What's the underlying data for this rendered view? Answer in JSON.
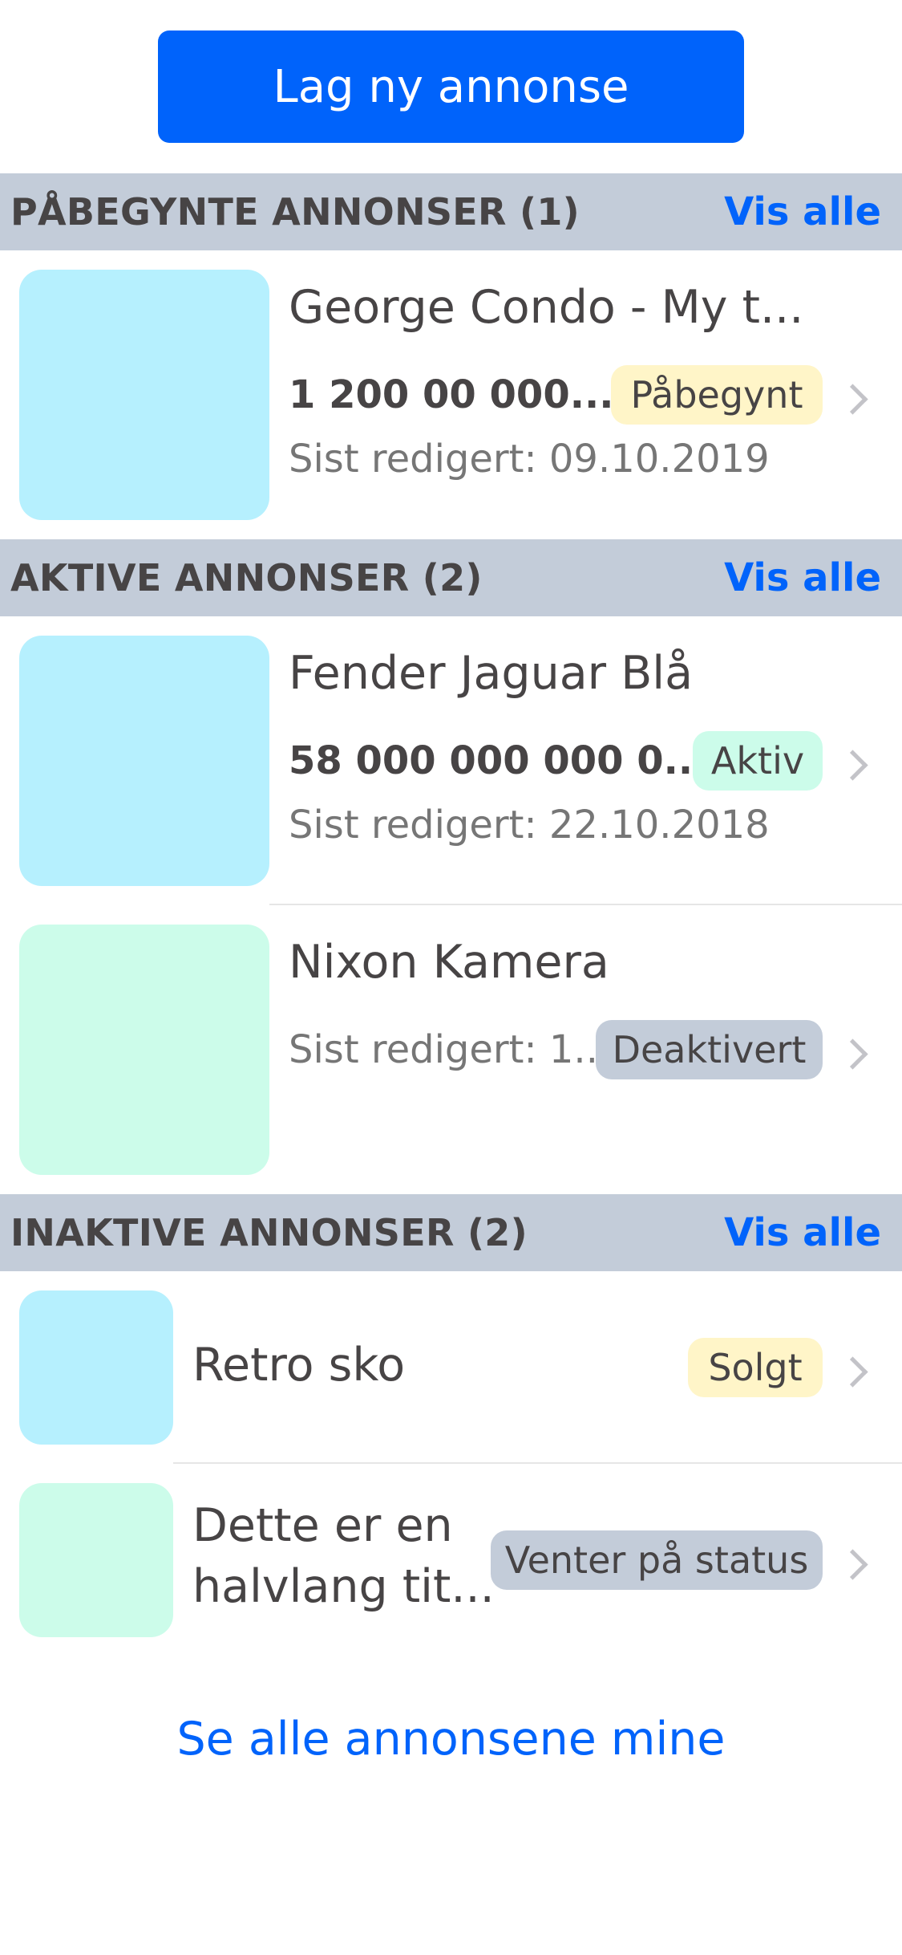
{
  "new_ad_button": "Lag ny annonse",
  "sections": {
    "started": {
      "title": "PÅBEGYNTE ANNONSER (1)",
      "see_all": "Vis alle",
      "items": [
        {
          "title": "George Condo - My t...",
          "price": "1 200 00 000...",
          "status": "Påbegynt",
          "edited": "Sist redigert: 09.10.2019",
          "thumb_color": "#b6f0fe"
        }
      ]
    },
    "active": {
      "title": "AKTIVE ANNONSER (2)",
      "see_all": "Vis alle",
      "items": [
        {
          "title": "Fender Jaguar Blå",
          "price": "58 000 000 000 0...",
          "status": "Aktiv",
          "edited": "Sist redigert: 22.10.2018",
          "thumb_color": "#b6f0fe"
        },
        {
          "title": "Nixon Kamera",
          "edited": "Sist redigert: 1...",
          "status": "Deaktivert",
          "thumb_color": "#ccfcea"
        }
      ]
    },
    "inactive": {
      "title": "INAKTIVE ANNONSER (2)",
      "see_all": "Vis alle",
      "items": [
        {
          "title": "Retro sko",
          "status": "Solgt",
          "thumb_color": "#b6f0fe"
        },
        {
          "title_line1": "Dette er en",
          "title_line2": "halvlang tit...",
          "status": "Venter på status",
          "thumb_color": "#ccfcea"
        }
      ]
    }
  },
  "footer_link": "Se alle annonsene mine",
  "colors": {
    "accent": "#0063fb",
    "header_bg": "#c3ccd9",
    "badge_started": "#fff5c8",
    "badge_active": "#ccfcea",
    "badge_neutral": "#c3ccd9"
  }
}
